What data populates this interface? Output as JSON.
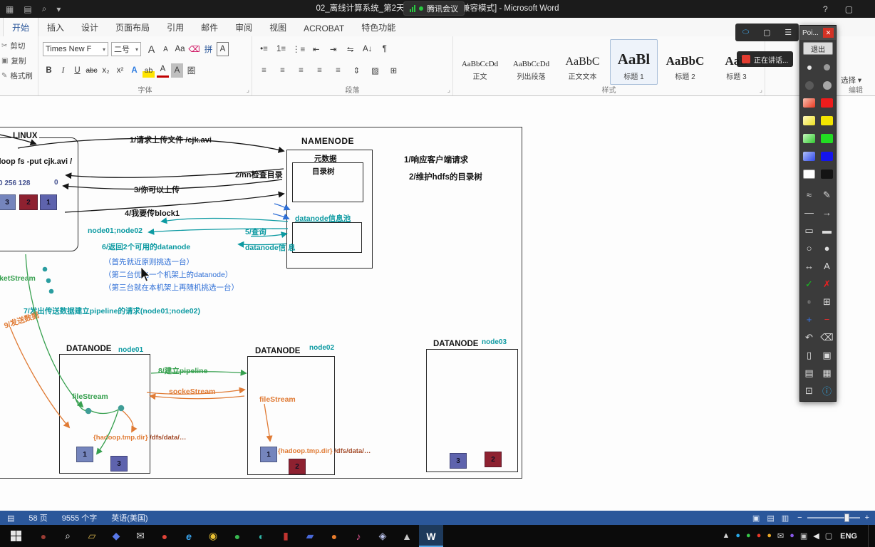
{
  "titlebar": {
    "title": "02_离线计算系统_第2天（HDFS详解）[兼容模式] - Microsoft Word",
    "meeting_pill": "腾讯会议",
    "quick": [
      {
        "glyph": "▦",
        "name": "save-icon"
      },
      {
        "glyph": "▤",
        "name": "file-icon"
      },
      {
        "glyph": "⌕",
        "name": "search-icon"
      },
      {
        "glyph": "▾",
        "name": "customize-quick-access-icon"
      }
    ],
    "window": [
      {
        "glyph": "?",
        "name": "help-icon"
      },
      {
        "glyph": "▢",
        "name": "ribbon-display-icon"
      }
    ]
  },
  "meeting": {
    "icons": [
      {
        "glyph": "⬭",
        "name": "meeting-share-icon",
        "cls": "blueic"
      },
      {
        "glyph": "▢",
        "name": "meeting-window-icon"
      },
      {
        "glyph": "☰",
        "name": "meeting-menu-icon"
      }
    ],
    "speaking": "正在讲话..."
  },
  "tabs": [
    {
      "label": "开始",
      "selected": true
    },
    {
      "label": "插入"
    },
    {
      "label": "设计"
    },
    {
      "label": "页面布局"
    },
    {
      "label": "引用"
    },
    {
      "label": "邮件"
    },
    {
      "label": "审阅"
    },
    {
      "label": "视图"
    },
    {
      "label": "ACROBAT"
    },
    {
      "label": "特色功能"
    }
  ],
  "ribbon": {
    "launcher_glyph": "⌟",
    "clipboard": {
      "items": [
        {
          "glyph": "✂",
          "label": "剪切",
          "name": "cut-button"
        },
        {
          "glyph": "▣",
          "label": "复制",
          "name": "copy-button"
        },
        {
          "glyph": "✎",
          "label": "格式刷",
          "name": "format-painter-button"
        }
      ]
    },
    "font": {
      "label": "字体",
      "name": "Times New F",
      "size": "二号",
      "row1": [
        {
          "glyph": "A",
          "cls": "fbig",
          "name": "grow-font-button"
        },
        {
          "glyph": "A",
          "cls": "fsmall",
          "name": "shrink-font-button"
        },
        {
          "glyph": "Aa",
          "name": "change-case-button"
        },
        {
          "glyph": "⌫",
          "cls": "pink",
          "name": "clear-formatting-button"
        },
        {
          "glyph": "拼",
          "cls": "blue",
          "name": "phonetic-guide-button"
        },
        {
          "glyph": "A",
          "cls": "boxed",
          "name": "character-border-button"
        }
      ],
      "row2": [
        {
          "glyph": "B",
          "cls": "b",
          "name": "bold-button"
        },
        {
          "glyph": "I",
          "cls": "i",
          "name": "italic-button"
        },
        {
          "glyph": "U",
          "cls": "u",
          "name": "underline-button"
        },
        {
          "glyph": "abc",
          "cls": "strike",
          "name": "strikethrough-button"
        },
        {
          "glyph": "x₂",
          "name": "subscript-button"
        },
        {
          "glyph": "x²",
          "name": "superscript-button"
        },
        {
          "glyph": "A",
          "cls": "glow",
          "name": "text-effects-button"
        },
        {
          "glyph": "ab",
          "cls": "hl",
          "name": "highlight-button"
        },
        {
          "glyph": "A",
          "cls": "fc",
          "name": "font-color-button"
        },
        {
          "glyph": "A",
          "cls": "shade",
          "name": "character-shading-button"
        },
        {
          "glyph": "圈",
          "name": "enclose-characters-button"
        }
      ]
    },
    "paragraph": {
      "label": "段落",
      "row1": [
        {
          "glyph": "•≡",
          "name": "bullets-button"
        },
        {
          "glyph": "1≡",
          "name": "numbering-button"
        },
        {
          "glyph": "⋮≡",
          "name": "multilevel-list-button"
        },
        {
          "glyph": "⇤",
          "name": "decrease-indent-button"
        },
        {
          "glyph": "⇥",
          "name": "increase-indent-button"
        },
        {
          "glyph": "⇋",
          "name": "asian-layout-button"
        },
        {
          "glyph": "A↓",
          "name": "sort-button"
        },
        {
          "glyph": "¶",
          "name": "show-marks-button"
        }
      ],
      "row2": [
        {
          "glyph": "≡",
          "name": "align-left-button"
        },
        {
          "glyph": "≡",
          "name": "align-center-button"
        },
        {
          "glyph": "≡",
          "name": "align-right-button"
        },
        {
          "glyph": "≡",
          "name": "justify-button"
        },
        {
          "glyph": "≡",
          "name": "distribute-button"
        },
        {
          "glyph": "⇕",
          "name": "line-spacing-button"
        },
        {
          "glyph": "▨",
          "name": "shading-button"
        },
        {
          "glyph": "⊞",
          "name": "borders-button"
        }
      ]
    },
    "styles": {
      "label": "样式",
      "items": [
        {
          "preview": "AaBbCcDd",
          "name": "正文",
          "cls": "s"
        },
        {
          "preview": "AaBbCcDd",
          "name": "列出段落",
          "cls": "s"
        },
        {
          "preview": "AaBbC",
          "name": "正文文本",
          "cls": "m"
        },
        {
          "preview": "AaBl",
          "name": "标题 1",
          "cls": "l",
          "selected": true
        },
        {
          "preview": "AaBbC",
          "name": "标题 2",
          "cls": "l2"
        },
        {
          "preview": "AaB",
          "name": "标题 3",
          "cls": "l2"
        }
      ]
    },
    "editing": {
      "label": "编辑",
      "select": "选择 ▾"
    }
  },
  "palette": {
    "title": "Poi...",
    "close_glyph": "✕",
    "exit": "退出",
    "swatches": [
      {
        "cls": "chip dot d6",
        "bg": "#e8e8e8",
        "name": "pen-size-small"
      },
      {
        "cls": "chip dot d9",
        "bg": "#9a9a9a",
        "name": "pen-size-medium"
      },
      {
        "cls": "chip dot d12",
        "bg": "#5a5a5a",
        "name": "pen-size-large"
      },
      {
        "cls": "chip dot d12",
        "bg": "#a8a8a8",
        "name": "pen-size-xlarge"
      },
      {
        "cls": "chip",
        "bg": "linear-gradient(135deg,#f8c0b0,#e83820)",
        "name": "color-red-light"
      },
      {
        "cls": "chip",
        "bg": "#ee1c1c",
        "name": "color-red"
      },
      {
        "cls": "chip",
        "bg": "linear-gradient(135deg,#fcf8c0,#eee020)",
        "name": "color-yellow-light"
      },
      {
        "cls": "chip",
        "bg": "#f2e400",
        "name": "color-yellow"
      },
      {
        "cls": "chip",
        "bg": "linear-gradient(135deg,#c8f8c0,#30c830)",
        "name": "color-green-light"
      },
      {
        "cls": "chip",
        "bg": "#22dd22",
        "name": "color-green"
      },
      {
        "cls": "chip",
        "bg": "linear-gradient(135deg,#b0c0f8,#3048e8)",
        "name": "color-blue-light"
      },
      {
        "cls": "chip",
        "bg": "#1414ee",
        "name": "color-blue"
      },
      {
        "cls": "chip sw-border",
        "bg": "#ffffff",
        "name": "color-white"
      },
      {
        "cls": "chip",
        "bg": "#141414",
        "name": "color-black"
      }
    ],
    "tools": [
      {
        "glyph": "≈",
        "name": "curve-tool"
      },
      {
        "glyph": "✎",
        "name": "pen-tool"
      },
      {
        "glyph": "—",
        "name": "line-tool"
      },
      {
        "glyph": "→",
        "name": "arrow-tool"
      },
      {
        "glyph": "▭",
        "name": "rectangle-tool"
      },
      {
        "glyph": "▬",
        "name": "filled-rectangle-tool"
      },
      {
        "glyph": "○",
        "name": "ellipse-tool"
      },
      {
        "glyph": "●",
        "name": "filled-ellipse-tool"
      },
      {
        "glyph": "↔",
        "name": "double-arrow-tool"
      },
      {
        "glyph": "A",
        "name": "text-tool"
      },
      {
        "glyph": "✓",
        "color": "#18c020",
        "name": "check-mark-tool"
      },
      {
        "glyph": "✗",
        "color": "#e82020",
        "name": "cross-mark-tool"
      },
      {
        "glyph": "▫",
        "name": "dashed-rect-tool"
      },
      {
        "glyph": "⊞",
        "name": "magnifier-tool"
      },
      {
        "glyph": "+",
        "color": "#3878f0",
        "name": "plus-tool"
      },
      {
        "glyph": "−",
        "color": "#e83030",
        "name": "minus-tool"
      },
      {
        "glyph": "↶",
        "name": "undo-tool"
      },
      {
        "glyph": "⌫",
        "name": "trash-tool"
      },
      {
        "glyph": "▯",
        "name": "new-page-tool"
      },
      {
        "glyph": "▣",
        "name": "copy-tool"
      },
      {
        "glyph": "▤",
        "name": "printer-tool"
      },
      {
        "glyph": "▦",
        "name": "save-tool"
      },
      {
        "glyph": "⊡",
        "name": "screenshot-tool"
      },
      {
        "glyph": "ⓘ",
        "color": "#30a8e8",
        "name": "info-tool"
      }
    ]
  },
  "diagram": {
    "colors": {
      "block_blue": "#7585bd",
      "block_red": "#8e2130",
      "block_purple": "#5e63ad",
      "teal": "#0d9aa2",
      "blue": "#2f6fd6",
      "green": "#37a04f",
      "orange": "#e07b35"
    },
    "linux": {
      "title": "LINUX",
      "command": "hadoop fs -put  cjk.avi   /",
      "offsets": "0 256 128",
      "offset_end": "0",
      "blocks": [
        {
          "label": "3",
          "color": "blue"
        },
        {
          "label": "2",
          "color": "red"
        },
        {
          "label": "1",
          "color": "purple"
        }
      ]
    },
    "namenode": {
      "title": "NAMENODE",
      "metadata": "元数据",
      "tree": "目录树",
      "pool": "datanode信息池"
    },
    "steps": {
      "s1": "1/请求上传文件  /cjk.avi",
      "s2": "2/nn检查目录",
      "s3": "3/你可以上传",
      "s4": "4/我要传block1",
      "s5": "5/查询",
      "s5_info": "datanode信 息",
      "node_list": "node01;node02",
      "s6": "6/返回2个可用的datanode",
      "rule1": "（首先就近原则挑选一台）",
      "rule2": "（第二台优先一个机架上的datanode）",
      "rule3": "（第三台就在本机架上再随机挑选一台）",
      "s7": "7/发出传送数据建立pipeline的请求(node01;node02)",
      "s8": "8/建立pipeline",
      "s9": "9/发送数据",
      "socket_stream": "socketStream",
      "socke_stream": "sockeStream",
      "file_stream": "fileStream",
      "resp1": "1/响应客户端请求",
      "resp2": "2/维护hdfs的目录树",
      "tmp_dir": "{hadoop.tmp.dir}",
      "dfs_path": "/dfs/data/…"
    },
    "datanode1": {
      "title": "DATANODE",
      "node": "node01",
      "blocks": [
        {
          "label": "1",
          "color": "blue"
        },
        {
          "label": "3",
          "color": "purple"
        }
      ]
    },
    "datanode2": {
      "title": "DATANODE",
      "node": "node02",
      "blocks": [
        {
          "label": "1",
          "color": "blue"
        },
        {
          "label": "2",
          "color": "red"
        }
      ]
    },
    "datanode3": {
      "title": "DATANODE",
      "node": "node03",
      "blocks": [
        {
          "label": "3",
          "color": "purple"
        },
        {
          "label": "2",
          "color": "red"
        }
      ]
    }
  },
  "statusbar": {
    "page_icon": "▤",
    "page_label": "58 页",
    "word_count": "9555 个字",
    "language": "英语(美国)",
    "view_icons": [
      {
        "glyph": "▣",
        "name": "read-mode-icon"
      },
      {
        "glyph": "▤",
        "name": "print-layout-icon"
      },
      {
        "glyph": "▥",
        "name": "web-layout-icon"
      }
    ],
    "zoom_minus": "−",
    "zoom_plus": "+"
  },
  "taskbar": {
    "apps": [
      {
        "glyph": "●",
        "color": "#9a3c34",
        "name": "taskbar-app-icon"
      },
      {
        "glyph": "⌕",
        "color": "#e0e0e0",
        "name": "taskbar-search-icon"
      },
      {
        "glyph": "▱",
        "color": "#d8b44c",
        "name": "taskbar-folder-icon"
      },
      {
        "glyph": "◆",
        "color": "#5878e8",
        "name": "taskbar-app-icon"
      },
      {
        "glyph": "✉",
        "color": "#d8d8d8",
        "name": "taskbar-mail-icon"
      },
      {
        "glyph": "●",
        "color": "#e04438",
        "name": "taskbar-app-icon"
      },
      {
        "glyph": "e",
        "color": "#38a0e8",
        "cls": "ebold",
        "name": "taskbar-browser-icon"
      },
      {
        "glyph": "◉",
        "color": "#e8c034",
        "name": "taskbar-app-icon"
      },
      {
        "glyph": "●",
        "color": "#38b850",
        "name": "taskbar-app-icon"
      },
      {
        "glyph": "◐",
        "color": "#30b8a8",
        "name": "taskbar-app-icon"
      },
      {
        "glyph": "▮",
        "color": "#c23430",
        "name": "taskbar-app-icon"
      },
      {
        "glyph": "▰",
        "color": "#4868d8",
        "name": "taskbar-app-icon"
      },
      {
        "glyph": "●",
        "color": "#e87c2c",
        "name": "taskbar-app-icon"
      },
      {
        "glyph": "♪",
        "color": "#e85894",
        "name": "taskbar-app-icon"
      },
      {
        "glyph": "◈",
        "color": "#b8c0e8",
        "name": "taskbar-app-icon"
      },
      {
        "glyph": "▲",
        "color": "#c8c8c8",
        "name": "taskbar-app-icon"
      },
      {
        "glyph": "W",
        "color": "#ffffff",
        "cls": "active",
        "name": "taskbar-word-icon"
      }
    ],
    "tray": [
      {
        "glyph": "▲",
        "color": "#d8d8d8",
        "name": "tray-hidden-icons-icon"
      },
      {
        "glyph": "●",
        "color": "#28a8e8",
        "name": "tray-meeting-icon"
      },
      {
        "glyph": "●",
        "color": "#38c848",
        "name": "tray-icon"
      },
      {
        "glyph": "●",
        "color": "#e83828",
        "name": "tray-icon"
      },
      {
        "glyph": "●",
        "color": "#e8a828",
        "name": "tray-icon"
      },
      {
        "glyph": "✉",
        "color": "#d8d8d8",
        "name": "tray-mail-icon"
      },
      {
        "glyph": "●",
        "color": "#8858e8",
        "name": "tray-icon"
      },
      {
        "glyph": "▣",
        "color": "#c8c8c8",
        "name": "tray-icon"
      },
      {
        "glyph": "◀",
        "color": "#e8e8e8",
        "name": "volume-icon"
      },
      {
        "glyph": "▢",
        "color": "#d0d0d0",
        "name": "tray-icon"
      }
    ],
    "lang": "ENG"
  }
}
